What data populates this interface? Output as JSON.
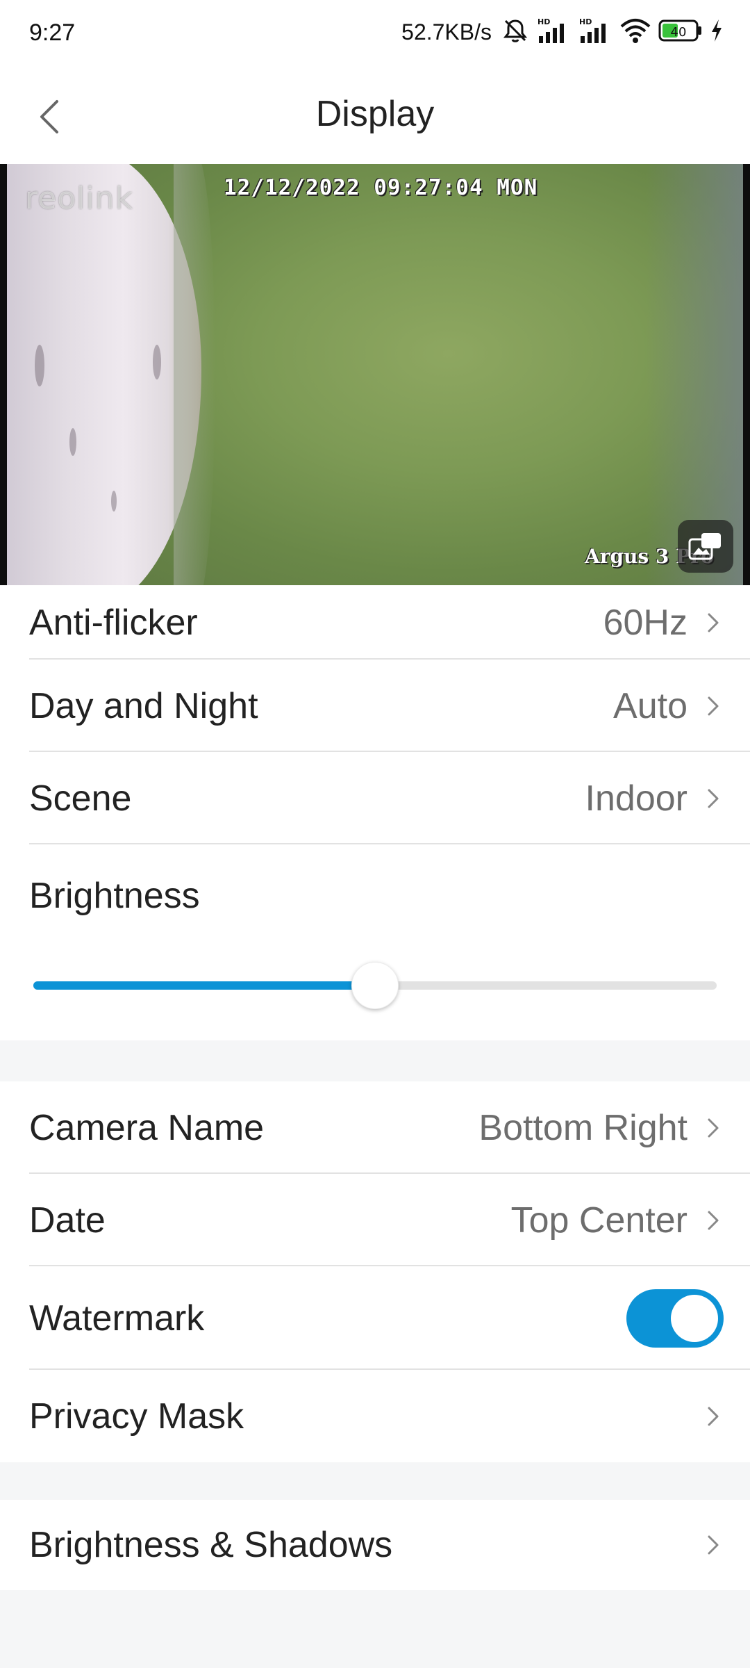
{
  "status_bar": {
    "time": "9:27",
    "net_speed": "52.7KB/s",
    "battery": "40",
    "icons": [
      "mute-icon",
      "hd-signal-icon",
      "hd-signal-icon",
      "wifi-icon",
      "battery-icon",
      "charging-icon"
    ]
  },
  "header": {
    "title": "Display",
    "back_icon": "chevron-left-icon"
  },
  "preview": {
    "logo": "reolink",
    "osd_date": "12/12/2022 09:27:04 MON",
    "osd_camera_name": "Argus 3 Pro",
    "pip_icon": "picture-in-picture-icon"
  },
  "group1": {
    "anti_flicker": {
      "label": "Anti-flicker",
      "value": "60Hz"
    },
    "day_night": {
      "label": "Day and Night",
      "value": "Auto"
    },
    "scene": {
      "label": "Scene",
      "value": "Indoor"
    },
    "brightness": {
      "label": "Brightness",
      "level": 0.5
    }
  },
  "group2": {
    "camera_name": {
      "label": "Camera Name",
      "value": "Bottom Right"
    },
    "date": {
      "label": "Date",
      "value": "Top Center"
    },
    "watermark": {
      "label": "Watermark",
      "enabled": true
    },
    "privacy_mask": {
      "label": "Privacy Mask"
    }
  },
  "group3": {
    "brightness_shadows": {
      "label": "Brightness & Shadows"
    }
  },
  "colors": {
    "accent": "#0c93d6",
    "value_text": "#6d6d6d",
    "background": "#f5f6f7"
  }
}
